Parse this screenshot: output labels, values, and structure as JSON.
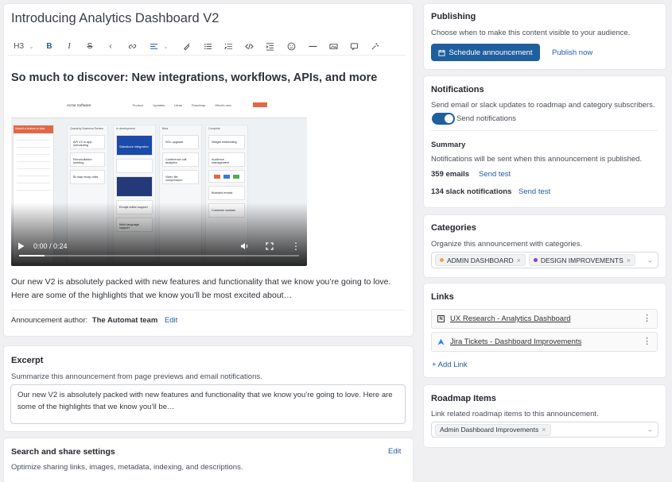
{
  "editor": {
    "title": "Introducing Analytics Dashboard V2",
    "toolbar": {
      "heading": "H3",
      "tools": [
        "bold-icon",
        "italic-icon",
        "strikethrough-icon",
        "chevron-left-icon",
        "link-icon",
        "align-icon",
        "paint-icon",
        "bullet-list-icon",
        "numbered-list-icon",
        "code-icon",
        "indent-icon",
        "emoji-icon",
        "divider-icon",
        "gallery-icon",
        "comment-icon",
        "magic-icon"
      ]
    },
    "heading": "So much to discover: New integrations, workflows, APIs, and more",
    "video": {
      "time": "0:00 / 0:24",
      "progress": 0.09,
      "screenshot": {
        "brand": "Acme Software",
        "nav": [
          "Product",
          "Updates",
          "Ideas",
          "Roadmap",
          "What's new"
        ],
        "columns": [
          "Quarterly Business Review",
          "In development",
          "Beta",
          "Complete"
        ],
        "cards": [
          [
            "API V2 in-app onboarding",
            "Reconciliation seeding",
            "Bi-map recap calls"
          ],
          [
            "Salesforce integration",
            "Emojis editor support",
            "Multi-language support"
          ],
          [
            "SOL upgrade",
            "Conference call analytics",
            "Video file compression"
          ],
          [
            "Widget embedding",
            "Audience management",
            "Branded emails",
            "Customer avatars"
          ]
        ],
        "side_title": "Submit a feature or idea"
      }
    },
    "body": "Our new V2 is absolutely packed with new features and functionality that we know you’re going to love. Here are some of the highlights that we know you’ll be most excited about…",
    "author_label": "Announcement author:",
    "author_name": "The Automat team",
    "author_edit": "Edit"
  },
  "excerpt": {
    "title": "Excerpt",
    "description": "Summarize this announcement from page previews and email notifications.",
    "value": "Our new V2 is absolutely packed with new features and functionality that we know you’re going to love. Here are some of the highlights that we know you’ll be…"
  },
  "search_share": {
    "title": "Search and share settings",
    "description": "Optimize sharing links, images, metadata, indexing, and descriptions.",
    "edit": "Edit"
  },
  "publishing": {
    "title": "Publishing",
    "description": "Choose when to make this content visible to your audience.",
    "schedule_button": "Schedule announcement",
    "publish_now": "Publish now"
  },
  "notifications": {
    "title": "Notifications",
    "description": "Send email or slack updates to roadmap and category subscribers.",
    "toggle_label": "Send notifications",
    "toggle_on": true,
    "summary_title": "Summary",
    "summary_description": "Notifications will be sent when this announcement is published.",
    "emails": "359 emails",
    "slack": "134 slack notifications",
    "send_test": "Send test"
  },
  "categories": {
    "title": "Categories",
    "description": "Organize this announcement with categories.",
    "items": [
      {
        "label": "ADMIN DASHBOARD",
        "color": "#f0a050"
      },
      {
        "label": "DESIGN IMPROVEMENTS",
        "color": "#8a3fd1"
      }
    ]
  },
  "links": {
    "title": "Links",
    "items": [
      {
        "label": "UX Research - Analytics Dashboard",
        "icon": "notion-icon"
      },
      {
        "label": "Jira Tickets - Dashboard Improvements",
        "icon": "jira-icon"
      }
    ],
    "add_link": "+ Add Link"
  },
  "roadmap": {
    "title": "Roadmap Items",
    "description": "Link related roadmap items to this announcement.",
    "items": [
      "Admin Dashboard Improvements"
    ]
  },
  "colors": {
    "primary": "#1f5f9e",
    "link": "#1d5c9e",
    "accent_orange": "#e06848"
  }
}
